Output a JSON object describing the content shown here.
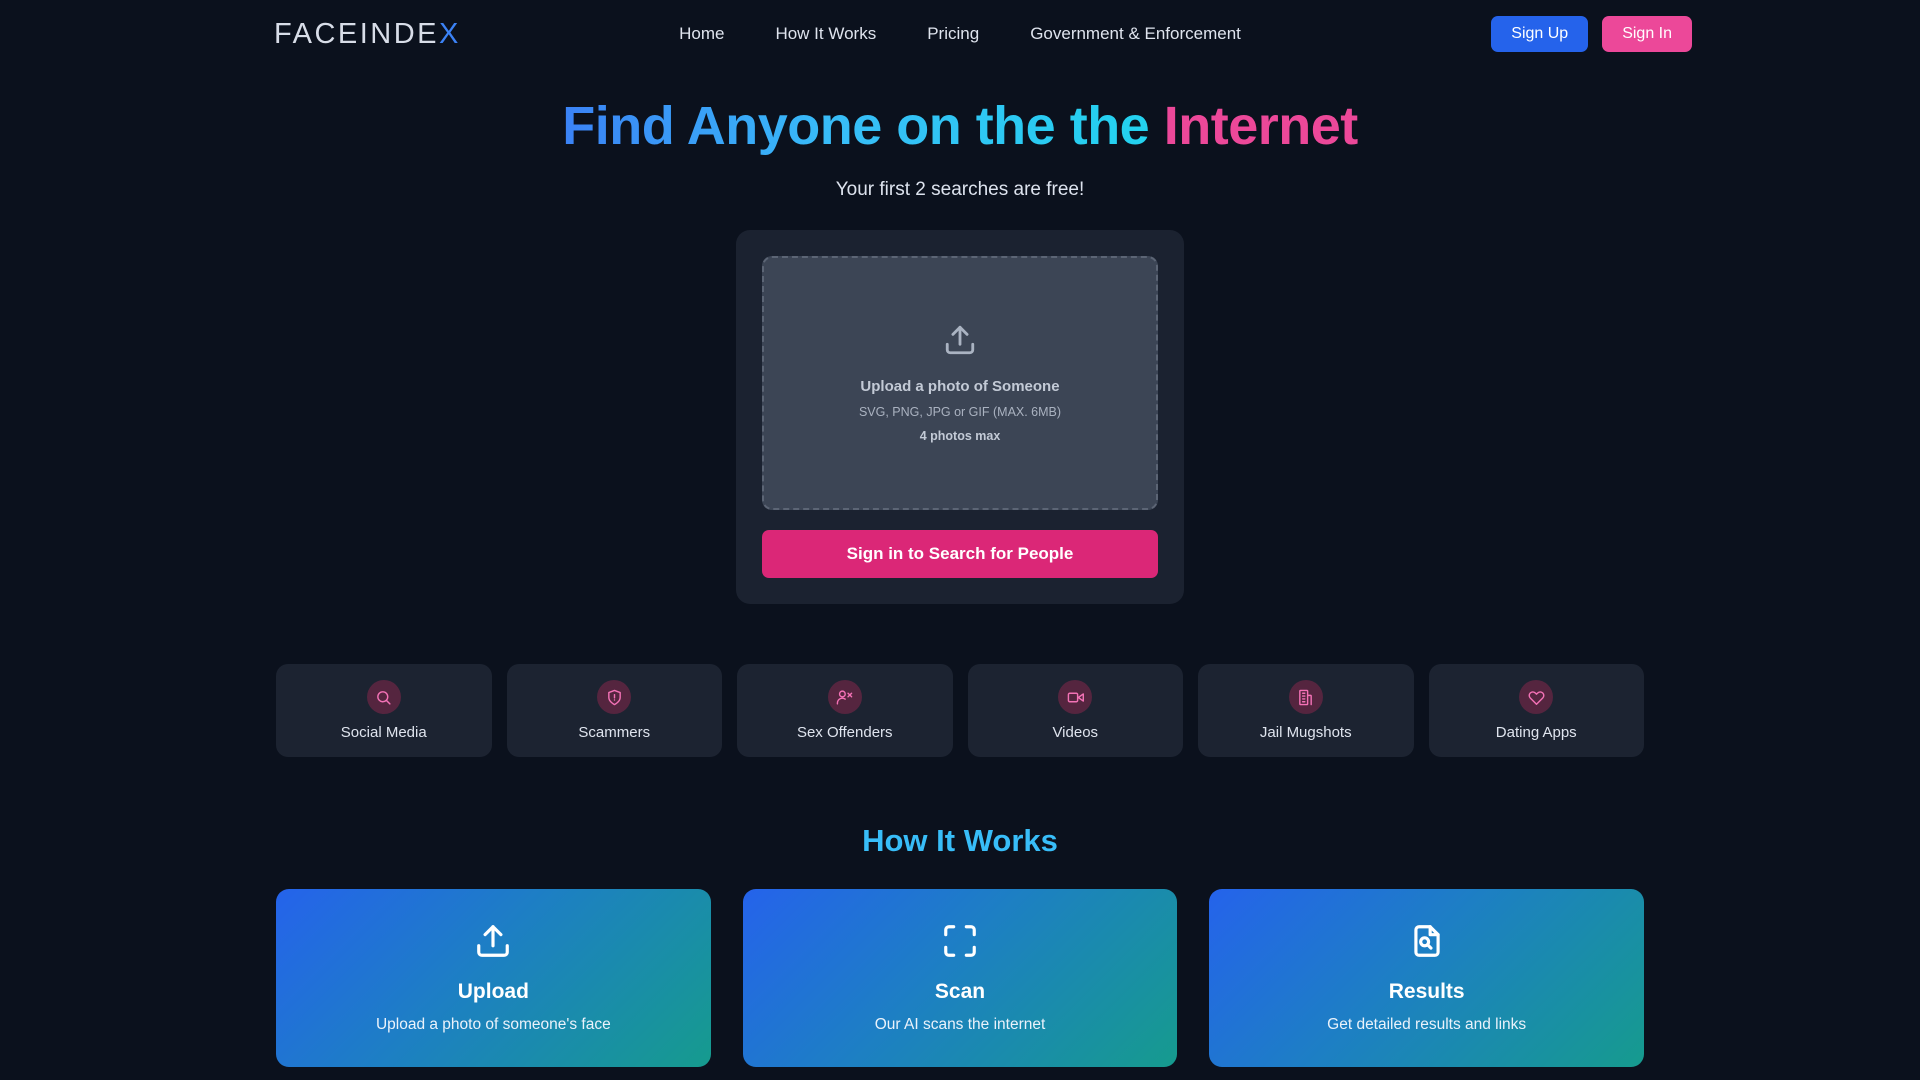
{
  "theme": {
    "page_bg": "#0b111d",
    "accent_blue": "#2563eb",
    "accent_cyan": "#38bdf8",
    "accent_pink": "#ec4899",
    "cta_pink": "#db2777",
    "panel_bg": "#1b2230",
    "dropzone_bg": "#3c4555",
    "card_bg": "#1c2331"
  },
  "header": {
    "logo_main": "FACEINDE",
    "logo_accent": "X",
    "nav": [
      {
        "label": "Home",
        "name": "nav-home"
      },
      {
        "label": "How It Works",
        "name": "nav-how-it-works"
      },
      {
        "label": "Pricing",
        "name": "nav-pricing"
      },
      {
        "label": "Government & Enforcement",
        "name": "nav-government-enforcement"
      }
    ],
    "sign_up_label": "Sign Up",
    "sign_in_label": "Sign In"
  },
  "hero": {
    "heading_part1": "Find Anyone on the the ",
    "heading_highlight": "Internet",
    "subtitle": "Your first 2 searches are free!"
  },
  "upload": {
    "icon": "upload-icon",
    "title": "Upload a photo of Someone",
    "formats": "SVG, PNG, JPG or GIF (MAX. 6MB)",
    "max_photos": "4 photos max",
    "cta_label": "Sign in to Search for People"
  },
  "categories": [
    {
      "label": "Social Media",
      "icon": "search-icon"
    },
    {
      "label": "Scammers",
      "icon": "shield-alert-icon"
    },
    {
      "label": "Sex Offenders",
      "icon": "user-x-icon"
    },
    {
      "label": "Videos",
      "icon": "video-camera-icon"
    },
    {
      "label": "Jail Mugshots",
      "icon": "building-icon"
    },
    {
      "label": "Dating Apps",
      "icon": "heart-icon"
    }
  ],
  "how_it_works": {
    "title": "How It Works",
    "steps": [
      {
        "name": "Upload",
        "desc": "Upload a photo of someone's face",
        "icon": "upload-icon"
      },
      {
        "name": "Scan",
        "desc": "Our AI scans the internet",
        "icon": "scan-frame-icon"
      },
      {
        "name": "Results",
        "desc": "Get detailed results and links",
        "icon": "file-search-icon"
      }
    ]
  }
}
